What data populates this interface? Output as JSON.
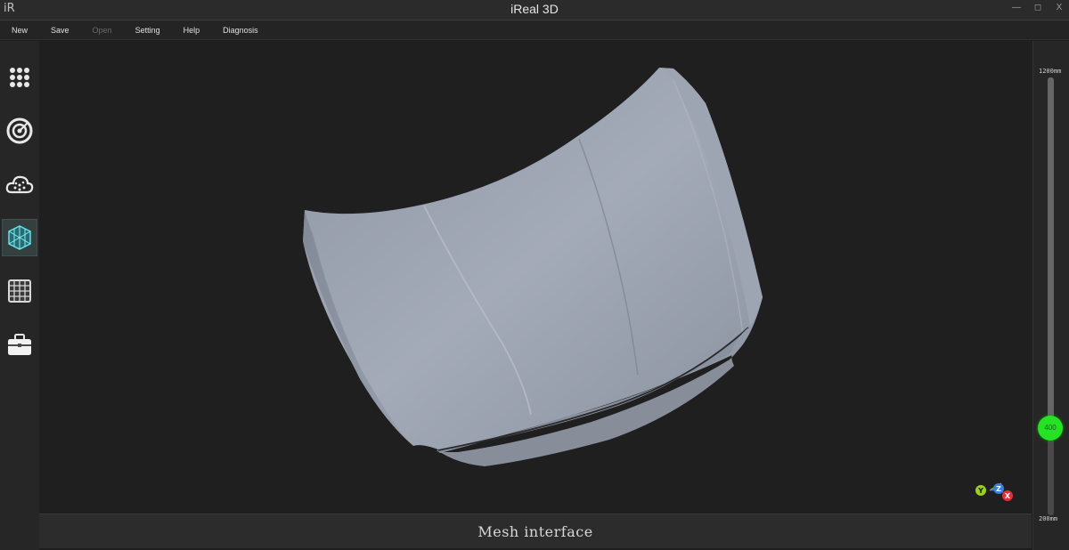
{
  "window": {
    "title": "iReal 3D",
    "logo": "iR",
    "controls": [
      "—",
      "◻",
      "X"
    ]
  },
  "menu": [
    {
      "label": "New",
      "enabled": true
    },
    {
      "label": "Save",
      "enabled": true
    },
    {
      "label": "Open",
      "enabled": false
    },
    {
      "label": "Setting",
      "enabled": true
    },
    {
      "label": "Help",
      "enabled": true
    },
    {
      "label": "Diagnosis",
      "enabled": true
    }
  ],
  "sidebar": {
    "items": [
      {
        "name": "dots-grid-icon",
        "active": false
      },
      {
        "name": "scan-target-icon",
        "active": false
      },
      {
        "name": "point-cloud-icon",
        "active": false
      },
      {
        "name": "mesh-cube-icon",
        "active": true
      },
      {
        "name": "grid-table-icon",
        "active": false
      },
      {
        "name": "toolbox-icon",
        "active": false
      }
    ]
  },
  "viewport": {
    "object": "car-hood-mesh"
  },
  "status": {
    "text": "Mesh interface"
  },
  "distance_slider": {
    "max_label": "1200mm",
    "min_label": "200mm",
    "value": 400,
    "value_label": "400",
    "min": 200,
    "max": 1200
  },
  "axis_gizmo": {
    "labels": [
      "Y",
      "Z",
      "X"
    ],
    "colors": [
      "#9ad01e",
      "#3a7fd8",
      "#e0303c"
    ]
  }
}
